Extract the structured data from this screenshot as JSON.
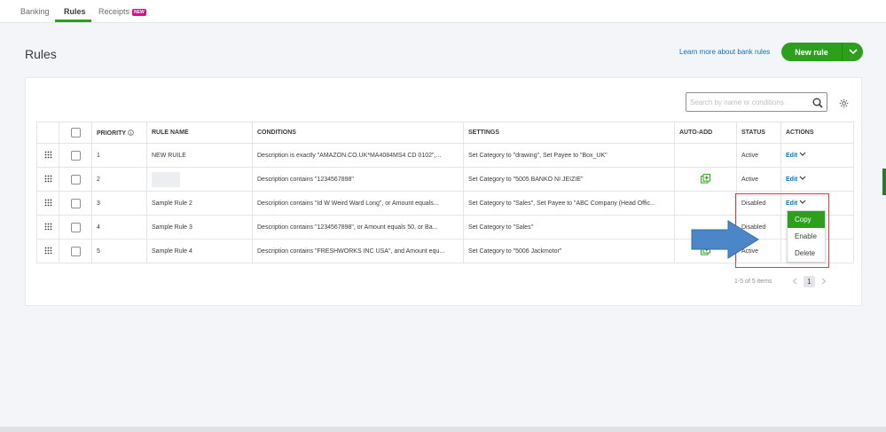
{
  "tabs": [
    {
      "label": "Banking",
      "active": false
    },
    {
      "label": "Rules",
      "active": true
    },
    {
      "label": "Receipts",
      "active": false,
      "badge": "NEW"
    }
  ],
  "page_title": "Rules",
  "learn_link": "Learn more about bank rules",
  "new_rule_button": "New rule",
  "search": {
    "placeholder": "Search by name or conditions",
    "value": ""
  },
  "table": {
    "headers": {
      "priority": "PRIORITY",
      "rule_name": "RULE NAME",
      "conditions": "CONDITIONS",
      "settings": "SETTINGS",
      "auto_add": "AUTO-ADD",
      "status": "STATUS",
      "actions": "ACTIONS"
    },
    "rows": [
      {
        "priority": "1",
        "name": "NEW RUILE",
        "conditions": "Description is exactly \"AMAZON.CO.UK*MA4084MS4 CD 0102\",...",
        "settings": "Set Category to \"drawing\", Set Payee to \"Box_UK\"",
        "auto_add": false,
        "status": "Active",
        "action": "Edit"
      },
      {
        "priority": "2",
        "name": "",
        "conditions": "Description contains \"1234567898\"",
        "settings": "Set Category to \"5005 BANKO NI JEIZIE\"",
        "auto_add": true,
        "status": "Active",
        "action": "Edit"
      },
      {
        "priority": "3",
        "name": "Sample Rule 2",
        "conditions": "Description contains \"Id W Weird Ward Long\", or Amount equals...",
        "settings": "Set Category to \"Sales\", Set Payee to \"ABC Company (Head Offic...",
        "auto_add": false,
        "status": "Disabled",
        "action": "Edit"
      },
      {
        "priority": "4",
        "name": "Sample Rule 3",
        "conditions": "Description contains \"1234567898\", or Amount equals 50, or Ba...",
        "settings": "Set Category to \"Sales\"",
        "auto_add": false,
        "status": "Disabled",
        "action": ""
      },
      {
        "priority": "5",
        "name": "Sample Rule 4",
        "conditions": "Description contains \"FRESHWORKS INC USA\", and Amount equ...",
        "settings": "Set Category to \"5006 Jackmotor\"",
        "auto_add": true,
        "status": "Active",
        "action": ""
      }
    ]
  },
  "action_menu": {
    "items": [
      "Copy",
      "Enable",
      "Delete"
    ],
    "highlighted": "Copy"
  },
  "pagination": {
    "info": "1-5 of 5 items",
    "current_page": "1"
  },
  "colors": {
    "accent": "#2ca01c",
    "link": "#0077c5",
    "highlight_box": "#e03c3c",
    "arrow": "#4a86c8"
  }
}
